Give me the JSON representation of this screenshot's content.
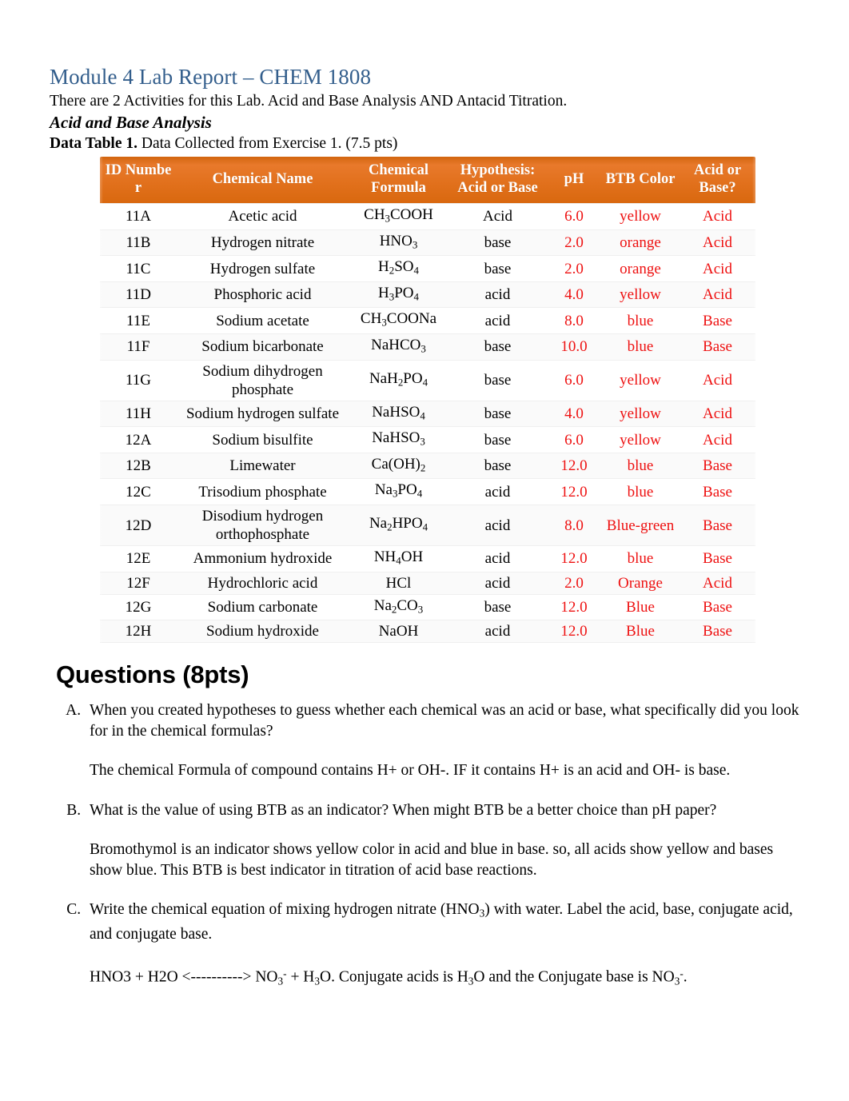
{
  "document": {
    "title": "Module 4 Lab Report – CHEM 1808",
    "title_color": "#335E8C",
    "intro": "There are 2 Activities for this Lab. Acid and Base Analysis AND Antacid Titration.",
    "section_heading": "Acid and Base Analysis",
    "table_caption_bold": "Data Table 1.",
    "table_caption_rest": " Data Collected from Exercise 1. (7.5 pts)"
  },
  "table": {
    "header_bg": "#E2711D",
    "header_text_color": "#FFFFFF",
    "value_red": "#EE1111",
    "columns": [
      "ID Numbe r",
      "Chemical Name",
      "Chemical Formula",
      "Hypothesis: Acid or Base",
      "pH",
      "BTB Color",
      "Acid or Base?"
    ],
    "rows": [
      {
        "id": "11A",
        "name": "Acetic acid",
        "formula_html": "CH<sub>3</sub>COOH",
        "hypothesis": "Acid",
        "ph": "6.0",
        "btb": "yellow",
        "result": "Acid"
      },
      {
        "id": "11B",
        "name": "Hydrogen nitrate",
        "formula_html": "HNO<sub>3</sub>",
        "hypothesis": "base",
        "ph": "2.0",
        "btb": "orange",
        "result": "Acid"
      },
      {
        "id": "11C",
        "name": "Hydrogen sulfate",
        "formula_html": "H<sub>2</sub>SO<sub>4</sub>",
        "hypothesis": "base",
        "ph": "2.0",
        "btb": "orange",
        "result": "Acid"
      },
      {
        "id": "11D",
        "name": "Phosphoric acid",
        "formula_html": "H<sub>3</sub>PO<sub>4</sub>",
        "hypothesis": "acid",
        "ph": "4.0",
        "btb": "yellow",
        "result": "Acid"
      },
      {
        "id": "11E",
        "name": "Sodium acetate",
        "formula_html": "CH<sub>3</sub>COONa",
        "hypothesis": "acid",
        "ph": "8.0",
        "btb": "blue",
        "result": "Base"
      },
      {
        "id": "11F",
        "name": "Sodium bicarbonate",
        "formula_html": "NaHCO<sub>3</sub>",
        "hypothesis": "base",
        "ph": "10.0",
        "btb": "blue",
        "result": "Base"
      },
      {
        "id": "11G",
        "name": "Sodium dihydrogen phosphate",
        "formula_html": "NaH<sub>2</sub>PO<sub>4</sub>",
        "hypothesis": "base",
        "ph": "6.0",
        "btb": "yellow",
        "result": "Acid"
      },
      {
        "id": "11H",
        "name": "Sodium hydrogen sulfate",
        "formula_html": "NaHSO<sub>4</sub>",
        "hypothesis": "base",
        "ph": "4.0",
        "btb": "yellow",
        "result": "Acid"
      },
      {
        "id": "12A",
        "name": "Sodium bisulfite",
        "formula_html": "NaHSO<sub>3</sub>",
        "hypothesis": "base",
        "ph": "6.0",
        "btb": "yellow",
        "result": "Acid"
      },
      {
        "id": "12B",
        "name": "Limewater",
        "formula_html": "Ca(OH)<sub>2</sub>",
        "hypothesis": "base",
        "ph": "12.0",
        "btb": "blue",
        "result": "Base"
      },
      {
        "id": "12C",
        "name": "Trisodium phosphate",
        "formula_html": "Na<sub>3</sub>PO<sub>4</sub>",
        "hypothesis": "acid",
        "ph": "12.0",
        "btb": "blue",
        "result": "Base"
      },
      {
        "id": "12D",
        "name": "Disodium hydrogen orthophosphate",
        "formula_html": "Na<sub>2</sub>HPO<sub>4</sub>",
        "hypothesis": "acid",
        "ph": "8.0",
        "btb": "Blue-green",
        "result": "Base"
      },
      {
        "id": "12E",
        "name": "Ammonium hydroxide",
        "formula_html": "NH<sub>4</sub>OH",
        "hypothesis": "acid",
        "ph": "12.0",
        "btb": "blue",
        "result": "Base"
      },
      {
        "id": "12F",
        "name": "Hydrochloric acid",
        "formula_html": "HCl",
        "hypothesis": "acid",
        "ph": "2.0",
        "btb": "Orange",
        "result": "Acid"
      },
      {
        "id": "12G",
        "name": "Sodium carbonate",
        "formula_html": "Na<sub>2</sub>CO<sub>3</sub>",
        "hypothesis": "base",
        "ph": "12.0",
        "btb": "Blue",
        "result": "Base"
      },
      {
        "id": "12H",
        "name": "Sodium hydroxide",
        "formula_html": "NaOH",
        "hypothesis": "acid",
        "ph": "12.0",
        "btb": "Blue",
        "result": "Base"
      }
    ]
  },
  "questions": {
    "heading": "Questions (8pts)",
    "items": [
      {
        "letter": "A",
        "question_html": "When you created hypotheses to guess whether each chemical was an acid or base, what specifically did you look for in the chemical formulas?",
        "answer_html": "The chemical Formula of compound contains H+ or OH-. IF it contains H+ is an acid and OH- is base."
      },
      {
        "letter": "B",
        "question_html": "What is the value of using BTB as an indicator? When might BTB be a better choice than pH paper?",
        "answer_html": "Bromothymol is an indicator shows yellow color in acid and blue in base. so, all acids show yellow and bases show blue. This BTB is best indicator in titration of acid base reactions."
      },
      {
        "letter": "C",
        "question_html": "Write the chemical equation of mixing hydrogen nitrate (HNO<sub>3</sub>) with water. Label the acid, base, conjugate acid, and conjugate base.",
        "answer_html": "HNO3 + H2O &lt;----------&gt; NO<sub>3</sub><sup>-</sup> + H<sub>3</sub>O. Conjugate acids is H<sub>3</sub>O and the Conjugate base is NO<sub>3</sub><sup>-</sup>."
      }
    ]
  }
}
